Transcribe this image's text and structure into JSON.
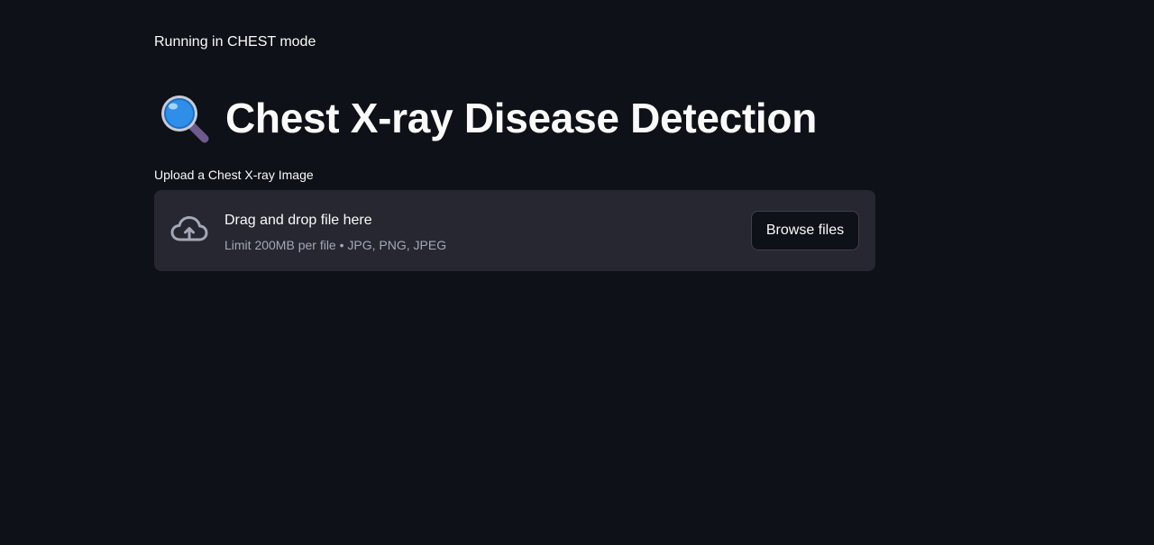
{
  "mode_banner": "Running in CHEST mode",
  "title": {
    "icon": "magnifying-glass-icon",
    "text": "Chest X-ray Disease Detection"
  },
  "uploader": {
    "label": "Upload a Chest X-ray Image",
    "icon": "cloud-upload-icon",
    "drop_title": "Drag and drop file here",
    "drop_subtitle": "Limit 200MB per file • JPG, PNG, JPEG",
    "browse_label": "Browse files"
  },
  "colors": {
    "background": "#0e1117",
    "dropzone": "#262730",
    "text": "#fafafa",
    "muted_text": "#a3a8b8"
  }
}
